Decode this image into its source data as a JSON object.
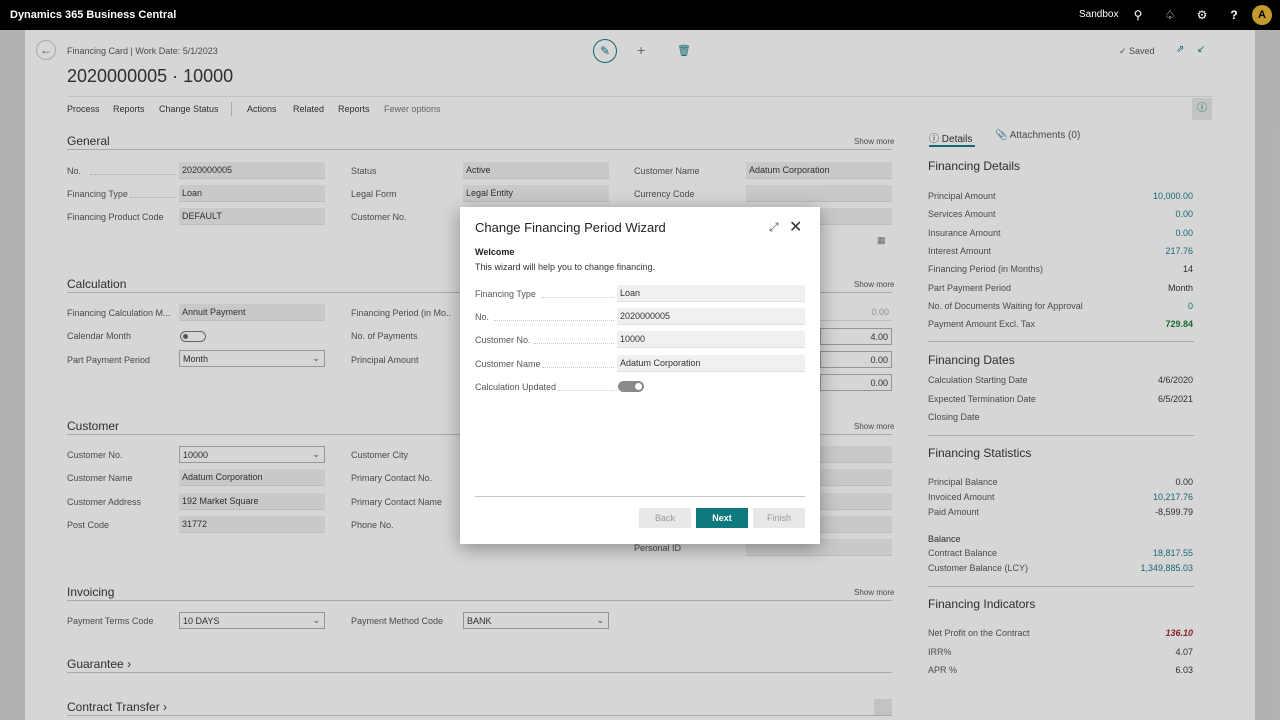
{
  "topbar": {
    "app_name": "Dynamics 365 Business Central",
    "environment": "Sandbox",
    "avatar_initial": "A"
  },
  "page": {
    "breadcrumb": "Financing Card | Work Date: 5/1/2023",
    "title": "2020000005 · 10000",
    "saved_label": "Saved",
    "menu": [
      "Process",
      "Reports",
      "Change Status",
      "Actions",
      "Related",
      "Reports",
      "Fewer options"
    ]
  },
  "general": {
    "header": "General",
    "show_more": "Show more",
    "no_label": "No.",
    "no_value": "2020000005",
    "financing_type_label": "Financing Type",
    "financing_type_value": "Loan",
    "product_code_label": "Financing Product Code",
    "product_code_value": "DEFAULT",
    "status_label": "Status",
    "status_value": "Active",
    "legal_form_label": "Legal Form",
    "legal_form_value": "Legal Entity",
    "customer_no_label": "Customer No.",
    "customer_name_label": "Customer Name",
    "customer_name_value": "Adatum Corporation",
    "currency_code_label": "Currency Code"
  },
  "calculation": {
    "header": "Calculation",
    "show_more": "Show more",
    "calc_method_label": "Financing Calculation M...",
    "calc_method_value": "Annuit Payment",
    "calendar_month_label": "Calendar Month",
    "part_payment_label": "Part Payment Period",
    "part_payment_value": "Month",
    "period_label": "Financing Period (in Mo...",
    "no_payments_label": "No. of Payments",
    "principal_label": "Principal Amount",
    "right_values": [
      "0.00",
      "4.00",
      "0.00",
      "0.00"
    ]
  },
  "customer": {
    "header": "Customer",
    "show_more": "Show more",
    "no_label": "Customer No.",
    "no_value": "10000",
    "name_label": "Customer Name",
    "name_value": "Adatum Corporation",
    "address_label": "Customer Address",
    "address_value": "192 Market Square",
    "post_code_label": "Post Code",
    "post_code_value": "31772",
    "city_label": "Customer City",
    "primary_contact_no_label": "Primary Contact No.",
    "primary_contact_name_label": "Primary Contact Name",
    "phone_label": "Phone No.",
    "personal_id_label": "Personal ID"
  },
  "invoicing": {
    "header": "Invoicing",
    "show_more": "Show more",
    "terms_label": "Payment Terms Code",
    "terms_value": "10 DAYS",
    "method_label": "Payment Method Code",
    "method_value": "BANK"
  },
  "guarantee": {
    "header": "Guarantee"
  },
  "contract_transfer": {
    "header": "Contract Transfer"
  },
  "factbox": {
    "tab_details": "Details",
    "tab_attachments": "Attachments (0)",
    "details": {
      "header": "Financing Details",
      "rows": [
        {
          "label": "Principal Amount",
          "value": "10,000.00"
        },
        {
          "label": "Services Amount",
          "value": "0.00"
        },
        {
          "label": "Insurance Amount",
          "value": "0.00"
        },
        {
          "label": "Interest Amount",
          "value": "217.76"
        },
        {
          "label": "Financing Period (in Months)",
          "value": "14"
        },
        {
          "label": "Part Payment Period",
          "value": "Month"
        },
        {
          "label": "No. of Documents Waiting for Approval",
          "value": "0"
        },
        {
          "label": "Payment Amount Excl. Tax",
          "value": "729.84"
        }
      ]
    },
    "dates": {
      "header": "Financing Dates",
      "rows": [
        {
          "label": "Calculation Starting Date",
          "value": "4/6/2020"
        },
        {
          "label": "Expected Termination Date",
          "value": "6/5/2021"
        },
        {
          "label": "Closing Date",
          "value": ""
        }
      ]
    },
    "statistics": {
      "header": "Financing Statistics",
      "rows": [
        {
          "label": "Principal Balance",
          "value": "0.00"
        },
        {
          "label": "Invoiced Amount",
          "value": "10,217.76"
        },
        {
          "label": "Paid Amount",
          "value": "-8,599.79"
        }
      ],
      "balance_header": "Balance",
      "balance_rows": [
        {
          "label": "Contract Balance",
          "value": "18,817.55"
        },
        {
          "label": "Customer Balance (LCY)",
          "value": "1,349,885.03"
        }
      ]
    },
    "indicators": {
      "header": "Financing Indicators",
      "rows": [
        {
          "label": "Net Profit on the Contract",
          "value": "136.10"
        },
        {
          "label": "IRR%",
          "value": "4.07"
        },
        {
          "label": "APR %",
          "value": "6.03"
        }
      ]
    }
  },
  "dialog": {
    "title": "Change Financing Period Wizard",
    "welcome": "Welcome",
    "intro": "This wizard will help you to change financing.",
    "fields": [
      {
        "label": "Financing Type",
        "value": "Loan"
      },
      {
        "label": "No.",
        "value": "2020000005"
      },
      {
        "label": "Customer No.",
        "value": "10000"
      },
      {
        "label": "Customer Name",
        "value": "Adatum Corporation"
      }
    ],
    "calc_updated_label": "Calculation Updated",
    "back_label": "Back",
    "next_label": "Next",
    "finish_label": "Finish"
  },
  "colors": {
    "accent": "#0e7a80",
    "link": "#1a7a84",
    "negative": "#a4262c",
    "topbar": "#000000"
  }
}
